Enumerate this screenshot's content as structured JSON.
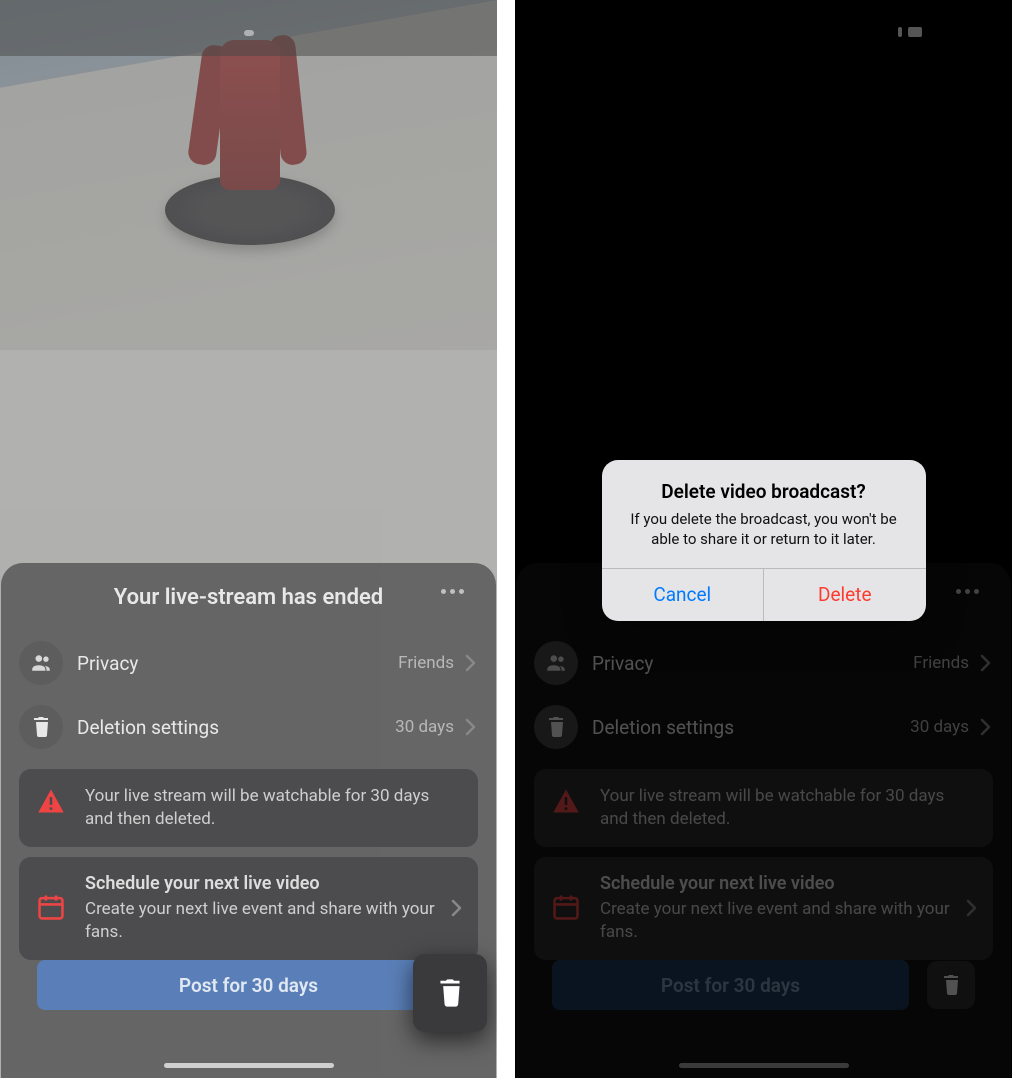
{
  "sheet": {
    "title": "Your live-stream has ended",
    "privacy_label": "Privacy",
    "privacy_value": "Friends",
    "deletion_label": "Deletion settings",
    "deletion_value": "30 days",
    "warning_text": "Your live stream will be watchable for 30 days and then deleted.",
    "schedule_title": "Schedule your next live video",
    "schedule_subtitle": "Create your next live event and share with your fans.",
    "post_button": "Post for 30 days"
  },
  "alert": {
    "title": "Delete video broadcast?",
    "message": "If you delete the broadcast, you won't be able to share it or return to it later.",
    "cancel": "Cancel",
    "delete": "Delete"
  },
  "icons": {
    "more": "more-icon",
    "people": "people-icon",
    "trash": "trash-icon",
    "warning": "warning-icon",
    "calendar": "calendar-icon",
    "chevron": "chevron-right-icon"
  },
  "colors": {
    "accent_blue": "#1877f2",
    "danger_red": "#e41e3f",
    "ios_blue": "#007aff",
    "ios_red": "#ff3b30"
  }
}
